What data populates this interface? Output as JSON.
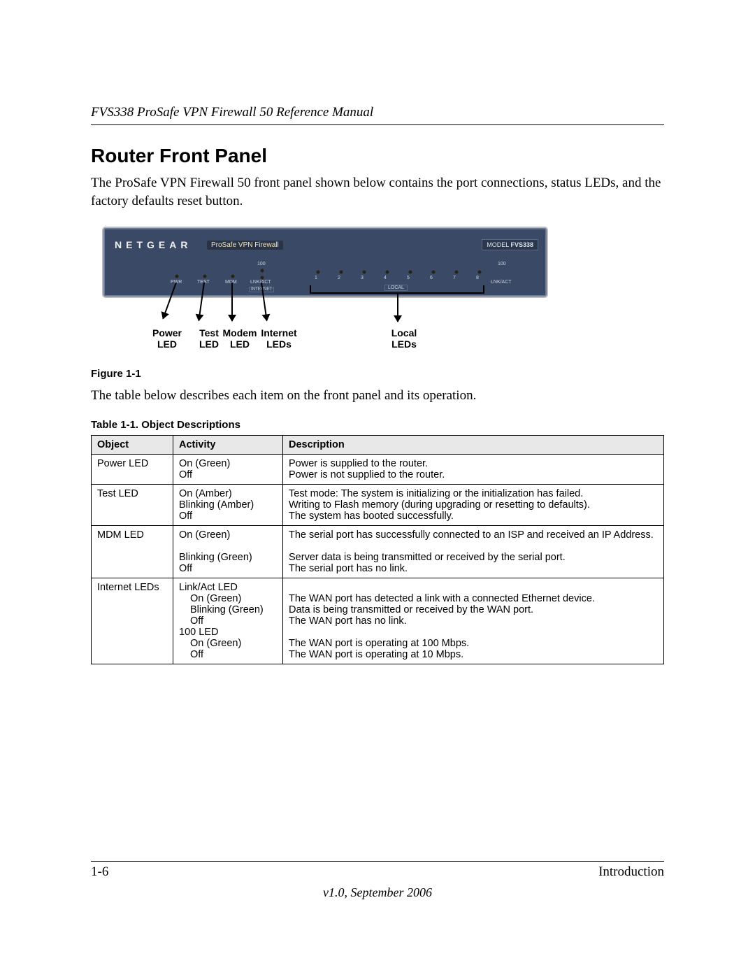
{
  "header": {
    "running_title": "FVS338 ProSafe VPN Firewall 50 Reference Manual"
  },
  "section": {
    "title": "Router Front Panel",
    "intro": "The ProSafe VPN Firewall 50 front panel shown below contains the port connections, status LEDs, and the factory defaults reset button.",
    "after_figure": "The table below describes each item on the front panel and its operation."
  },
  "figure": {
    "caption": "Figure 1-1",
    "brand": "NETGEAR",
    "product_label": "ProSafe VPN Firewall",
    "model_prefix": "MODEL",
    "model": "FVS338",
    "panel_labels": {
      "pwr": "PWR",
      "test": "TEST",
      "mdm": "MDM",
      "hundred": "100",
      "lnkact": "LNK/ACT",
      "internet": "INTERNET",
      "local": "LOCAL",
      "ports": [
        "1",
        "2",
        "3",
        "4",
        "5",
        "6",
        "7",
        "8"
      ]
    },
    "callouts": {
      "power": "Power\nLED",
      "test": "Test\nLED",
      "modem": "Modem\nLED",
      "internet": "Internet\nLEDs",
      "local": "Local\nLEDs"
    }
  },
  "table": {
    "caption": "Table 1-1.   Object Descriptions",
    "headers": {
      "object": "Object",
      "activity": "Activity",
      "description": "Description"
    },
    "rows": [
      {
        "object": "Power LED",
        "activity": [
          "On (Green)",
          "Off"
        ],
        "description": [
          "Power is supplied to the router.",
          "Power is not supplied to the router."
        ]
      },
      {
        "object": "Test LED",
        "activity": [
          "On (Amber)",
          "Blinking (Amber)",
          "Off"
        ],
        "description": [
          "Test mode: The system is initializing or the initialization has failed.",
          "Writing to Flash memory (during upgrading or resetting to defaults).",
          "The system has booted successfully."
        ]
      },
      {
        "object": "MDM LED",
        "activity": [
          "On (Green)",
          "",
          "Blinking (Green)",
          "Off"
        ],
        "description": [
          "The serial port has successfully connected to an ISP and received an IP Address.",
          "",
          "Server data is being transmitted or received by the serial port.",
          "The serial port has no link."
        ]
      },
      {
        "object": "Internet LEDs",
        "groups": [
          {
            "title": "Link/Act LED",
            "items": [
              {
                "a": "On (Green)",
                "d": "The WAN port has detected a link with a connected Ethernet device."
              },
              {
                "a": "Blinking (Green)",
                "d": "Data is being transmitted or received by the WAN port."
              },
              {
                "a": "Off",
                "d": "The WAN port has no link."
              }
            ]
          },
          {
            "title": "100 LED",
            "items": [
              {
                "a": "On (Green)",
                "d": "The WAN port is operating at 100 Mbps."
              },
              {
                "a": "Off",
                "d": "The WAN port is operating at 10 Mbps."
              }
            ]
          }
        ]
      }
    ]
  },
  "footer": {
    "page": "1-6",
    "chapter": "Introduction",
    "version": "v1.0, September 2006"
  }
}
